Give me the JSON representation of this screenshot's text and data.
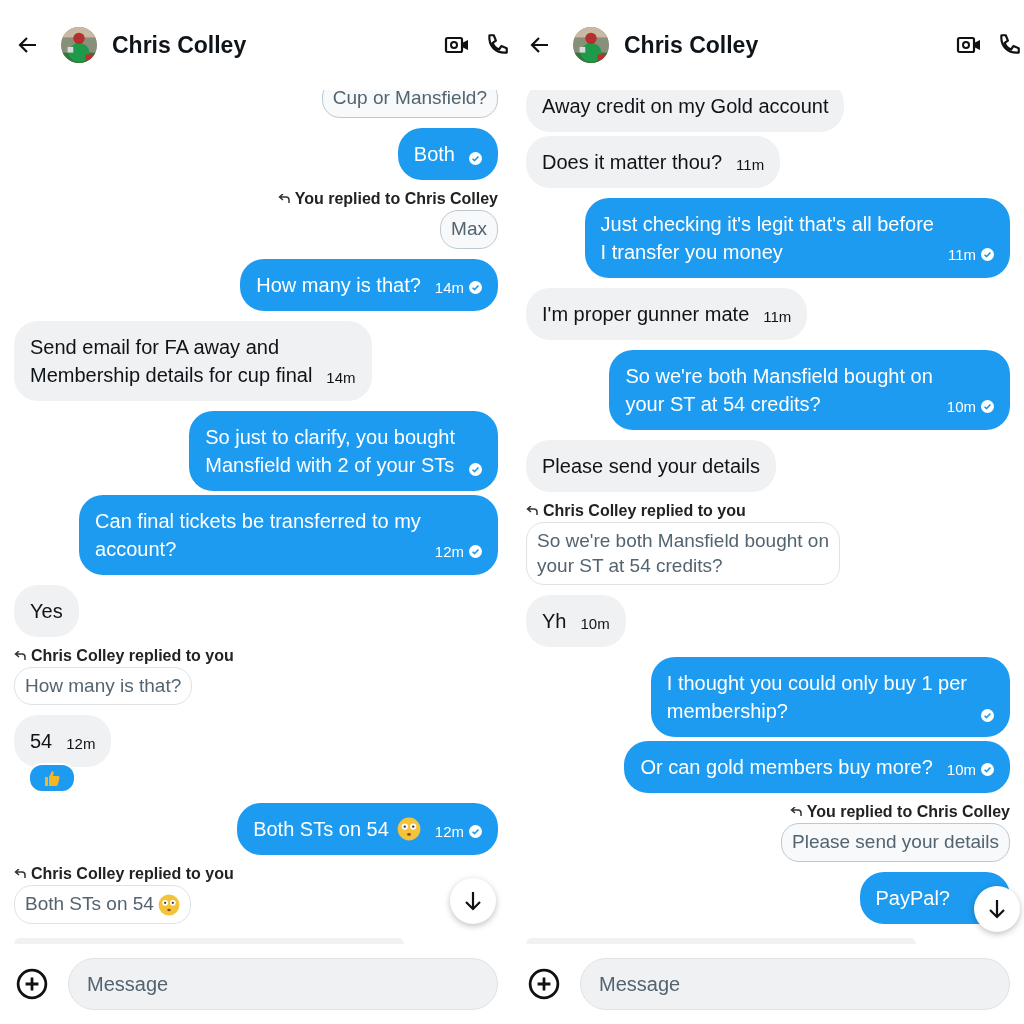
{
  "panels": [
    {
      "contact": {
        "name": "Chris Colley"
      },
      "messages": [
        {
          "kind": "quote",
          "from_me": true,
          "text": "Cup or Mansfield?"
        },
        {
          "kind": "msg",
          "from_me": true,
          "text": "Both",
          "sent": true
        },
        {
          "kind": "reply_label",
          "from_me": true,
          "text": "You replied to Chris Colley"
        },
        {
          "kind": "quote",
          "from_me": true,
          "text": "Max"
        },
        {
          "kind": "msg",
          "from_me": true,
          "text": "How many is that?",
          "time": "14m",
          "sent": true
        },
        {
          "kind": "msg",
          "from_me": false,
          "text": "Send email for FA away and\nMembership details for cup final",
          "time": "14m"
        },
        {
          "kind": "msg",
          "from_me": true,
          "text": "So just to clarify, you bought\nMansfield with 2 of your STs",
          "sent": true
        },
        {
          "kind": "msg",
          "from_me": true,
          "text": "Can final tickets be transferred to my\naccount?",
          "time": "12m",
          "sent": true
        },
        {
          "kind": "msg",
          "from_me": false,
          "text": "Yes"
        },
        {
          "kind": "reply_label",
          "from_me": false,
          "text": "Chris Colley replied to you"
        },
        {
          "kind": "quote",
          "from_me": false,
          "text": "How many is that?"
        },
        {
          "kind": "msg",
          "from_me": false,
          "text": "54",
          "time": "12m",
          "reaction": true
        },
        {
          "kind": "msg",
          "from_me": true,
          "text": "Both STs on 54",
          "emoji": true,
          "time": "12m",
          "sent": true
        },
        {
          "kind": "reply_label",
          "from_me": false,
          "text": "Chris Colley replied to you"
        },
        {
          "kind": "quote",
          "from_me": false,
          "text": "Both STs on 54",
          "emoji": true
        },
        {
          "kind": "partial",
          "from_me": false
        }
      ],
      "composer": {
        "placeholder": "Message"
      }
    },
    {
      "contact": {
        "name": "Chris Colley"
      },
      "messages": [
        {
          "kind": "msg",
          "from_me": false,
          "text": "Away credit on my Gold account"
        },
        {
          "kind": "msg",
          "from_me": false,
          "text": "Does it matter thou?",
          "time": "11m"
        },
        {
          "kind": "msg",
          "from_me": true,
          "text": "Just checking it's legit that's all before\nI transfer you money",
          "time": "11m",
          "sent": true
        },
        {
          "kind": "msg",
          "from_me": false,
          "text": "I'm proper gunner mate",
          "time": "11m"
        },
        {
          "kind": "msg",
          "from_me": true,
          "text": "So we're both Mansfield bought on\nyour ST at 54 credits?",
          "time": "10m",
          "sent": true
        },
        {
          "kind": "msg",
          "from_me": false,
          "text": "Please send your details"
        },
        {
          "kind": "reply_label",
          "from_me": false,
          "text": "Chris Colley replied to you"
        },
        {
          "kind": "quote",
          "from_me": false,
          "text": "So we're both Mansfield bought on\nyour ST at 54 credits?"
        },
        {
          "kind": "msg",
          "from_me": false,
          "text": "Yh",
          "time": "10m"
        },
        {
          "kind": "msg",
          "from_me": true,
          "text": "I thought you could only buy 1 per\nmembership?",
          "sent": true
        },
        {
          "kind": "msg",
          "from_me": true,
          "text": "Or can gold members buy more?",
          "time": "10m",
          "sent": true
        },
        {
          "kind": "reply_label",
          "from_me": true,
          "text": "You replied to Chris Colley"
        },
        {
          "kind": "quote",
          "from_me": true,
          "text": "Please send your details"
        },
        {
          "kind": "msg",
          "from_me": true,
          "text": "PayPal?"
        },
        {
          "kind": "partial",
          "from_me": false
        }
      ],
      "composer": {
        "placeholder": "Message"
      }
    }
  ]
}
